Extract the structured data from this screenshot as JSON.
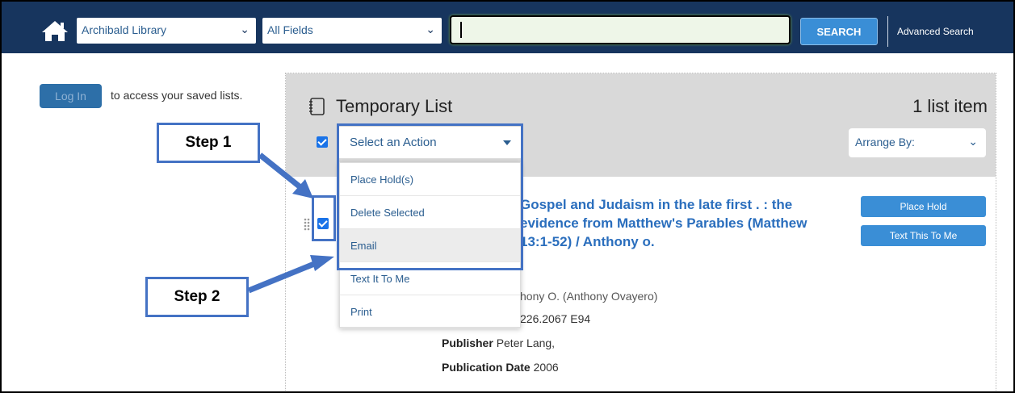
{
  "header": {
    "library_select": "Archibald Library",
    "field_select": "All Fields",
    "search_value": "",
    "search_label": "SEARCH",
    "advanced_label": "Advanced Search"
  },
  "login": {
    "button_label": "Log In",
    "prompt": "to access your saved lists."
  },
  "list": {
    "title": "Temporary List",
    "count": "1 list item",
    "arrange_label": "Arrange By:",
    "action_placeholder": "Select an Action",
    "actions": [
      "Place Hold(s)",
      "Delete Selected",
      "Email",
      "Text It To Me",
      "Print"
    ],
    "highlighted_action": "Email"
  },
  "item": {
    "title": "Gospel and Judaism in the late first . : the evidence from Matthew's Parables (Matthew 13:1-52) / Anthony o.",
    "author": "hony O. (Anthony Ovayero)",
    "call_number": "226.2067 E94",
    "publisher_label": "Publisher",
    "publisher": "Peter Lang,",
    "date_label": "Publication Date",
    "date": "2006",
    "place_hold_label": "Place Hold",
    "text_label": "Text This To Me"
  },
  "callouts": {
    "step1": "Step 1",
    "step2": "Step 2"
  },
  "colors": {
    "header_bg": "#17355e",
    "accent": "#3a8ed6",
    "callout_border": "#4472c4"
  }
}
